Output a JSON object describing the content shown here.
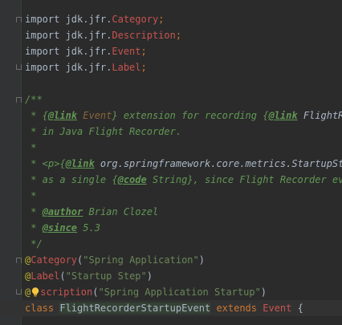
{
  "imports": [
    {
      "prefix": "import jdk.jfr.",
      "name": "Category",
      "suffix": ";"
    },
    {
      "prefix": "import jdk.jfr.",
      "name": "Description",
      "suffix": ";"
    },
    {
      "prefix": "import jdk.jfr.",
      "name": "Event",
      "suffix": ";"
    },
    {
      "prefix": "import jdk.jfr.",
      "name": "Label",
      "suffix": ";"
    }
  ],
  "javadoc": {
    "open": "/**",
    "l1_a": " * {",
    "l1_tag1": "@link",
    "l1_ref1": " Event",
    "l1_b": "} extension for recording {",
    "l1_tag2": "@link",
    "l1_ref2": " FlightRec",
    "l2": " * in Java Flight Recorder.",
    "l3": " *",
    "l4_a": " * <p>{",
    "l4_tag": "@link",
    "l4_ref": " org.springframework.core.metrics.StartupStep",
    "l5_a": " * as a single {",
    "l5_tag": "@code",
    "l5_b": " String}, since Flight Recorder even",
    "l6": " *",
    "l7_a": " * ",
    "l7_tag": "@author",
    "l7_b": " Brian Clozel",
    "l8_a": " * ",
    "l8_tag": "@since",
    "l8_b": " 5.3",
    "close": " */"
  },
  "annotations": [
    {
      "at": "@",
      "name": "Category",
      "open": "(",
      "value": "\"Spring Application\"",
      "close": ")"
    },
    {
      "at": "@",
      "name": "Label",
      "open": "(",
      "value": "\"Startup Step\"",
      "close": ")"
    },
    {
      "at": "@",
      "name": "scription",
      "open": "(",
      "value": "\"Spring Application Startup\"",
      "close": ")"
    }
  ],
  "class_decl": {
    "kw1": "class",
    "name": "FlightRecorderStartupEvent",
    "kw2": "extends",
    "parent": "Event",
    "brace": " {"
  },
  "colors": {
    "background": "#2b2b2b",
    "keyword": "#cc7832",
    "string": "#6a8759",
    "annotation": "#bbb529",
    "doc_comment": "#629755",
    "unresolved": "#c75450"
  },
  "icons": {
    "fold": "fold-marker-icon",
    "bulb": "intention-bulb-icon"
  }
}
